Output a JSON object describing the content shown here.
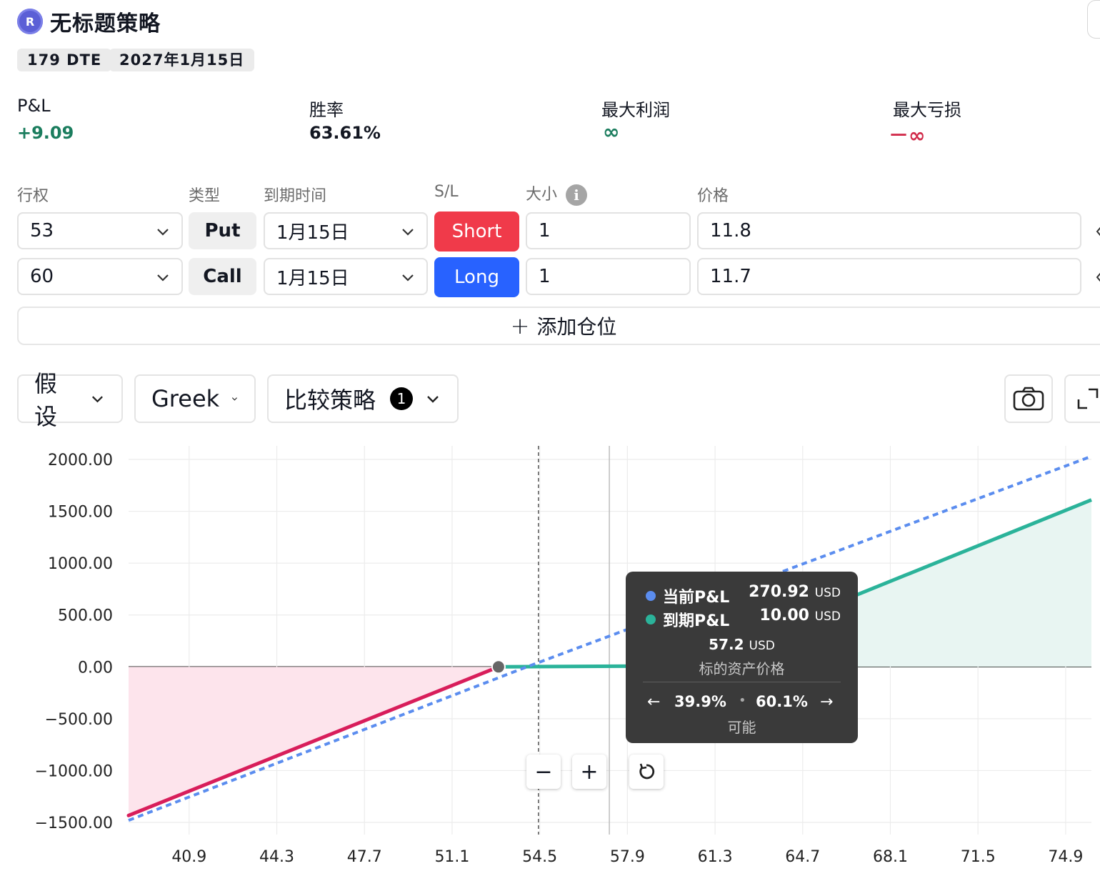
{
  "strategy": {
    "title": "无标题策略",
    "logo_letter": "R",
    "dte": "179 DTE",
    "expiry": "2027年1月15日"
  },
  "stats": [
    {
      "label": "P&L",
      "value": "+9.09"
    },
    {
      "label": "胜率",
      "value": "63.61%"
    },
    {
      "label": "最大利润",
      "value": "∞"
    },
    {
      "label": "最大亏损",
      "value": "－∞"
    }
  ],
  "columns": {
    "strike": "行权",
    "type": "类型",
    "expiry": "到期时间",
    "sl": "S/L",
    "size": "大小",
    "price": "价格"
  },
  "legs": [
    {
      "strike": "53",
      "type": "Put",
      "expiry": "1月15日",
      "side": "Short",
      "size": "1",
      "price": "11.8"
    },
    {
      "strike": "60",
      "type": "Call",
      "expiry": "1月15日",
      "side": "Long",
      "size": "1",
      "price": "11.7"
    }
  ],
  "add_position": "添加仓位",
  "toolbar": {
    "assume": "假设",
    "greek": "Greek",
    "compare": "比较策略",
    "compare_count": "1"
  },
  "tooltip": {
    "current_label": "当前P&L",
    "current_value": "270.92",
    "current_unit": "USD",
    "expiry_label": "到期P&L",
    "expiry_value": "10.00",
    "expiry_unit": "USD",
    "price_value": "57.2",
    "price_unit": "USD",
    "price_label": "标的资产价格",
    "prob_left": "39.9%",
    "prob_right": "60.1%",
    "prob_label": "可能"
  },
  "colors": {
    "current": "#5b8def",
    "expiry": "#2bb39a",
    "loss": "#d81e5b",
    "short": "#f03a4a",
    "long": "#2862ff"
  },
  "chart_data": {
    "type": "line",
    "x_ticks": [
      "40.9",
      "44.3",
      "47.7",
      "51.1",
      "54.5",
      "57.9",
      "61.3",
      "64.7",
      "68.1",
      "71.5",
      "74.9"
    ],
    "y_ticks": [
      "2000.00",
      "1500.00",
      "1000.00",
      "500.00",
      "0.00",
      "−500.00",
      "−1000.00",
      "−1500.00"
    ],
    "xlim": [
      38.55,
      75.9
    ],
    "ylim": [
      -1500,
      2000
    ],
    "series": [
      {
        "name": "到期P&L",
        "style": "solid",
        "points": [
          [
            38.55,
            -1433
          ],
          [
            52.9,
            0
          ],
          [
            60,
            10
          ],
          [
            75.9,
            1610
          ]
        ]
      },
      {
        "name": "当前P&L",
        "style": "dashed",
        "points": [
          [
            38.55,
            -1480
          ],
          [
            54,
            0
          ],
          [
            75.9,
            2030
          ]
        ]
      }
    ],
    "current_price": 54.45,
    "hover_price": 57.2
  }
}
